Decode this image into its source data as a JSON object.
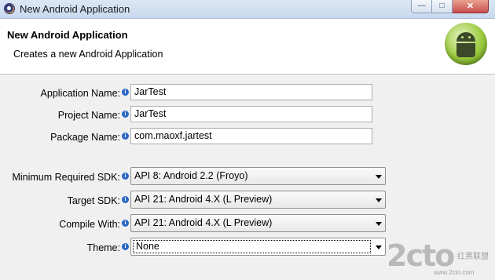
{
  "window": {
    "title": "New Android Application",
    "controls": {
      "minimize": "—",
      "maximize": "□",
      "close": "✕"
    }
  },
  "header": {
    "title": "New Android Application",
    "subtitle": "Creates a new Android Application"
  },
  "fields": {
    "application_name": {
      "label": "Application Name:",
      "value": "JarTest"
    },
    "project_name": {
      "label": "Project Name:",
      "value": "JarTest"
    },
    "package_name": {
      "label": "Package Name:",
      "value": "com.maoxf.jartest"
    }
  },
  "selects": {
    "min_sdk": {
      "label": "Minimum Required SDK:",
      "value": "API 8: Android 2.2 (Froyo)"
    },
    "target_sdk": {
      "label": "Target SDK:",
      "value": "API 21: Android 4.X (L Preview)"
    },
    "compile_with": {
      "label": "Compile With:",
      "value": "API 21: Android 4.X (L Preview)"
    },
    "theme": {
      "label": "Theme:",
      "value": "None"
    }
  },
  "info_glyph": "i",
  "watermark": {
    "big": "2cto",
    "small": "红黑联盟",
    "url": "www.2cto.com"
  },
  "colors": {
    "info_icon": "#2b67c6",
    "logo_green": "#9bcb3e",
    "close_button": "#c75050"
  }
}
